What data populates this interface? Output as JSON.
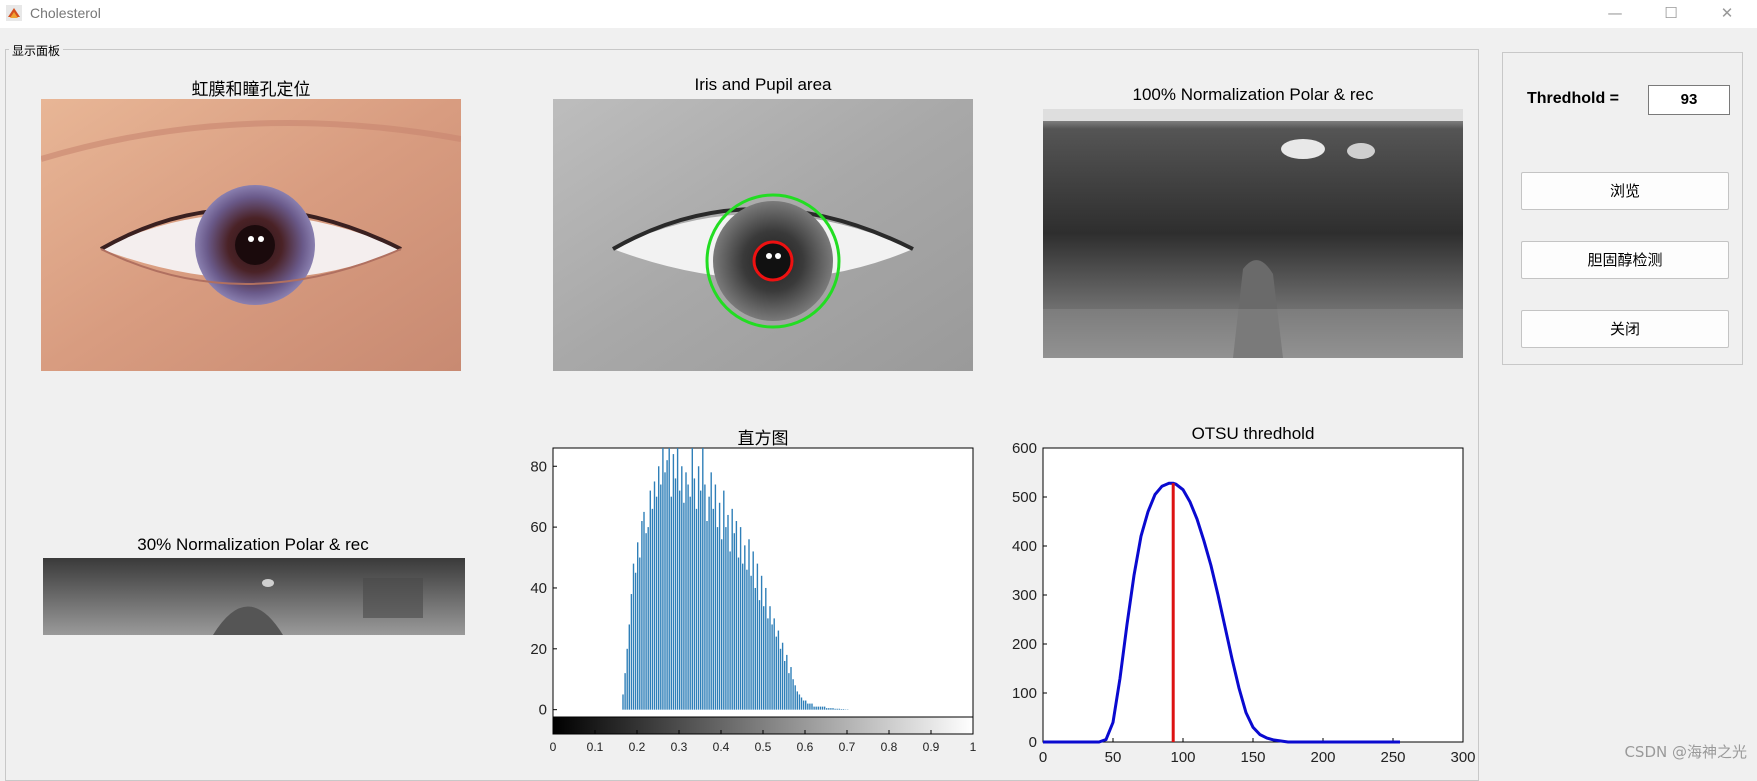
{
  "window": {
    "title": "Cholesterol",
    "minimize": "—",
    "maximize": "☐",
    "close": "✕"
  },
  "panel": {
    "legend": "显示面板"
  },
  "axes": {
    "iris_locate_title": "虹膜和瞳孔定位",
    "iris_area_title": "Iris and Pupil area",
    "norm100_title": "100% Normalization Polar & rec",
    "norm30_title": "30% Normalization Polar & rec",
    "histogram_title": "直方图",
    "otsu_title": "OTSU thredhold"
  },
  "controls": {
    "threshold_label": "Thredhold =",
    "threshold_value": "93",
    "browse_button": "浏览",
    "detect_button": "胆固醇检测",
    "close_button": "关闭"
  },
  "watermark": "CSDN @海神之光",
  "colors": {
    "histogram_bar": "#2f7fb8",
    "otsu_curve": "#0a0ad0",
    "otsu_threshold_line": "#dd1111",
    "iris_circle": "#22dd22",
    "pupil_circle": "#ee1111"
  },
  "chart_data": [
    {
      "type": "bar",
      "title": "直方图",
      "xlim": [
        0,
        1
      ],
      "ylim": [
        -8,
        86
      ],
      "x_ticks": [
        "0",
        "0.1",
        "0.2",
        "0.3",
        "0.4",
        "0.5",
        "0.6",
        "0.7",
        "0.8",
        "0.9",
        "1"
      ],
      "y_ticks": [
        "0",
        "20",
        "40",
        "60",
        "80"
      ],
      "colorbar": "grayscale 0 to 1",
      "x": [
        0.165,
        0.17,
        0.175,
        0.18,
        0.185,
        0.19,
        0.195,
        0.2,
        0.205,
        0.21,
        0.215,
        0.22,
        0.225,
        0.23,
        0.235,
        0.24,
        0.245,
        0.25,
        0.255,
        0.26,
        0.265,
        0.27,
        0.275,
        0.28,
        0.285,
        0.29,
        0.295,
        0.3,
        0.305,
        0.31,
        0.315,
        0.32,
        0.325,
        0.33,
        0.335,
        0.34,
        0.345,
        0.35,
        0.355,
        0.36,
        0.365,
        0.37,
        0.375,
        0.38,
        0.385,
        0.39,
        0.395,
        0.4,
        0.405,
        0.41,
        0.415,
        0.42,
        0.425,
        0.43,
        0.435,
        0.44,
        0.445,
        0.45,
        0.455,
        0.46,
        0.465,
        0.47,
        0.475,
        0.48,
        0.485,
        0.49,
        0.495,
        0.5,
        0.505,
        0.51,
        0.515,
        0.52,
        0.525,
        0.53,
        0.535,
        0.54,
        0.545,
        0.55,
        0.555,
        0.56,
        0.565,
        0.57,
        0.575,
        0.58,
        0.585,
        0.59,
        0.595,
        0.6,
        0.605,
        0.61,
        0.615,
        0.62,
        0.625,
        0.63,
        0.635,
        0.64,
        0.645,
        0.65,
        0.655,
        0.66,
        0.665,
        0.67,
        0.675,
        0.68,
        0.685,
        0.69,
        0.695,
        0.7
      ],
      "values": [
        5,
        12,
        20,
        28,
        38,
        48,
        45,
        55,
        50,
        62,
        65,
        58,
        60,
        72,
        66,
        75,
        70,
        80,
        74,
        86,
        78,
        82,
        86,
        70,
        84,
        76,
        86,
        72,
        80,
        68,
        78,
        74,
        70,
        86,
        76,
        66,
        80,
        72,
        86,
        74,
        62,
        70,
        78,
        66,
        74,
        60,
        68,
        56,
        72,
        60,
        64,
        52,
        66,
        58,
        62,
        50,
        60,
        48,
        54,
        46,
        56,
        44,
        52,
        40,
        48,
        36,
        44,
        34,
        40,
        30,
        34,
        28,
        30,
        24,
        26,
        20,
        22,
        16,
        18,
        12,
        14,
        10,
        8,
        6,
        5,
        4,
        3,
        3,
        2,
        2,
        2,
        1,
        1,
        1,
        1,
        1,
        1,
        0.5,
        0.5,
        0.5,
        0.5,
        0.3,
        0.3,
        0.3,
        0.2,
        0.2,
        0.1,
        0.1,
        0.1,
        0.1,
        0.1
      ]
    },
    {
      "type": "line",
      "title": "OTSU thredhold",
      "xlim": [
        0,
        300
      ],
      "ylim": [
        0,
        600
      ],
      "x_ticks": [
        "0",
        "50",
        "100",
        "150",
        "200",
        "250",
        "300"
      ],
      "y_ticks": [
        "0",
        "100",
        "200",
        "300",
        "400",
        "500",
        "600"
      ],
      "series": [
        {
          "x": [
            0,
            40,
            45,
            50,
            55,
            60,
            65,
            70,
            75,
            80,
            85,
            90,
            93,
            95,
            100,
            105,
            110,
            115,
            120,
            125,
            130,
            135,
            140,
            145,
            150,
            155,
            160,
            165,
            170,
            175,
            180,
            200,
            255
          ],
          "y": [
            0,
            0,
            5,
            40,
            130,
            240,
            340,
            420,
            470,
            505,
            522,
            528,
            528,
            526,
            515,
            490,
            455,
            410,
            360,
            300,
            235,
            170,
            110,
            60,
            30,
            15,
            8,
            4,
            2,
            0,
            0,
            0,
            0
          ]
        }
      ],
      "threshold_line": {
        "x": 93,
        "y": [
          0,
          528
        ]
      }
    }
  ]
}
